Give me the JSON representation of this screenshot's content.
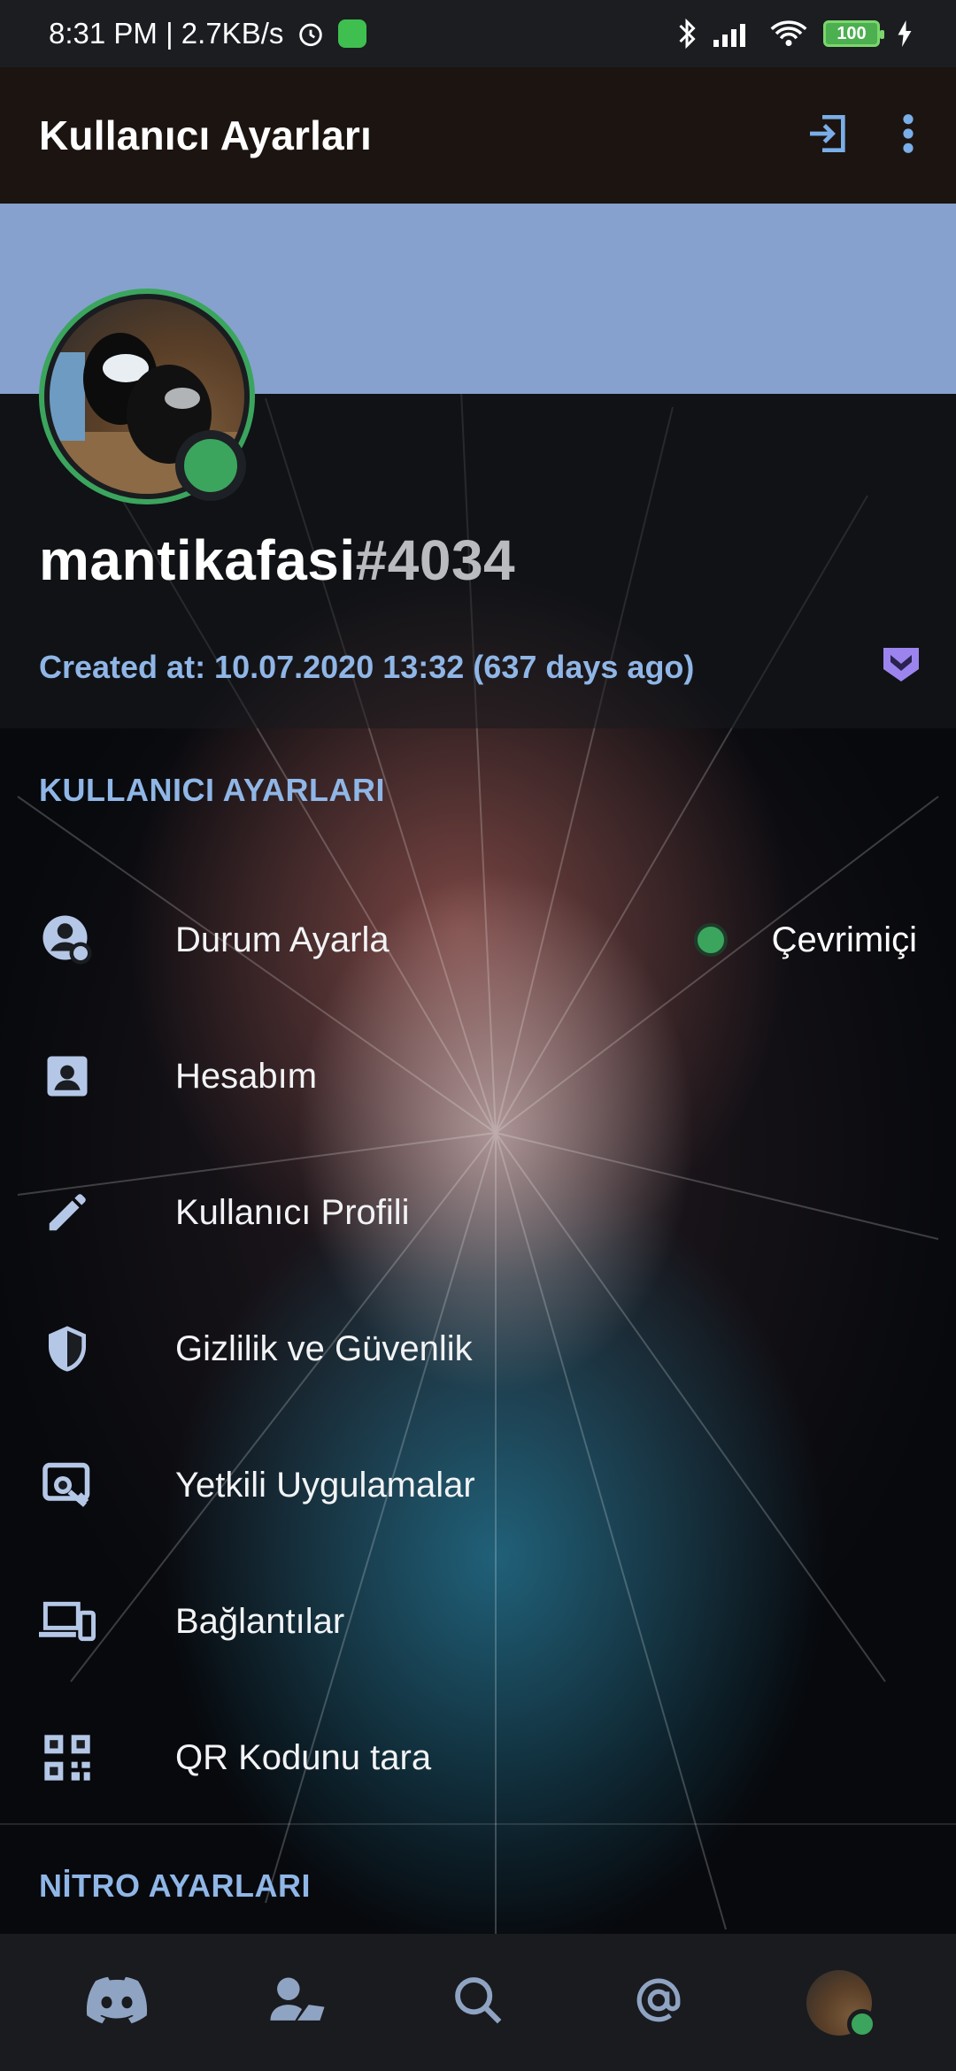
{
  "status_bar": {
    "time_speed": "8:31 PM | 2.7KB/s",
    "battery": "100"
  },
  "header": {
    "title": "Kullanıcı Ayarları",
    "icons": [
      "logout-icon",
      "more-vertical-icon"
    ]
  },
  "profile": {
    "username": "mantikafasi",
    "discriminator": "#4034",
    "created": "Created at: 10.07.2020 13:32 (637 days ago)",
    "banner_color": "#86a1ce",
    "status_color": "#3ba55d"
  },
  "sections": {
    "user_settings_title": "KULLANICI AYARLARI",
    "nitro_settings_title": "NİTRO AYARLARI"
  },
  "menu": [
    {
      "label": "Durum Ayarla",
      "icon": "status-icon",
      "trailing": "Çevrimiçi"
    },
    {
      "label": "Hesabım",
      "icon": "account-icon"
    },
    {
      "label": "Kullanıcı Profili",
      "icon": "pencil-icon"
    },
    {
      "label": "Gizlilik ve Güvenlik",
      "icon": "shield-icon"
    },
    {
      "label": "Yetkili Uygulamalar",
      "icon": "authorized-apps-icon"
    },
    {
      "label": "Bağlantılar",
      "icon": "devices-icon"
    },
    {
      "label": "QR Kodunu tara",
      "icon": "qr-code-icon"
    }
  ],
  "bottom_nav": [
    "discord-home-icon",
    "friends-icon",
    "search-icon",
    "mentions-icon",
    "profile-avatar"
  ]
}
